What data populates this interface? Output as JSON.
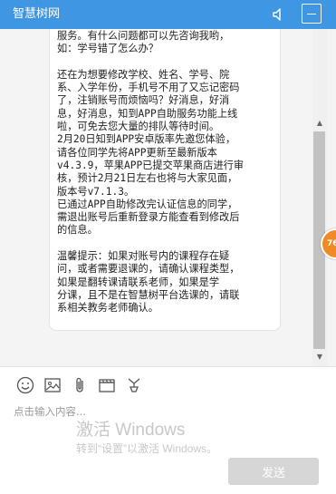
{
  "window": {
    "title": "智慧树网",
    "icons": {
      "speaker": "speaker-icon",
      "minimize": "minimize-icon"
    }
  },
  "chat": {
    "message": "服务。有什么问题都可以先咨询我哟，\n如：学号错了怎么办？\n\n还在为想要修改学校、姓名、学号、院\n系、入学年份，手机号不用了又忘记密码\n了，注销账号而烦恼吗？好消息，好消\n息，好消息，知到APP自助服务功能上线\n啦，可免去您大量的排队等待时间。\n2月20日知到APP安卓版率先邀您体验，\n请各位同学先将APP更新至最新版本\nv4.3.9，苹果APP已提交苹果商店进行审\n核，预计2月21日左右也将与大家见面，\n版本号v7.1.3。\n已通过APP自助修改完认证信息的同学，\n需退出账号后重新登录方能查看到修改后\n的信息。\n\n温馨提示：如果对账号内的课程存在疑\n问，或者需要退课的，请确认课程类型，\n如果是翻转课请联系老师，如果是学\n分课，且不是在智慧树平台选课的，请联\n系相关教务老师确认。"
  },
  "badge": {
    "text": "76"
  },
  "toolbar": {
    "icons": [
      "smiley-icon",
      "image-icon",
      "paperclip-icon",
      "clapperboard-icon",
      "evaluate-icon"
    ]
  },
  "input": {
    "placeholder": "点击输入内容..."
  },
  "watermark": {
    "title": "激活 Windows",
    "subtitle": "转到“设置”以激活 Windows。"
  },
  "send": {
    "label": "发送"
  },
  "colors": {
    "titlebar": "#3f97e4",
    "badge": "#f08a25",
    "send_disabled": "#d6d6d6"
  }
}
